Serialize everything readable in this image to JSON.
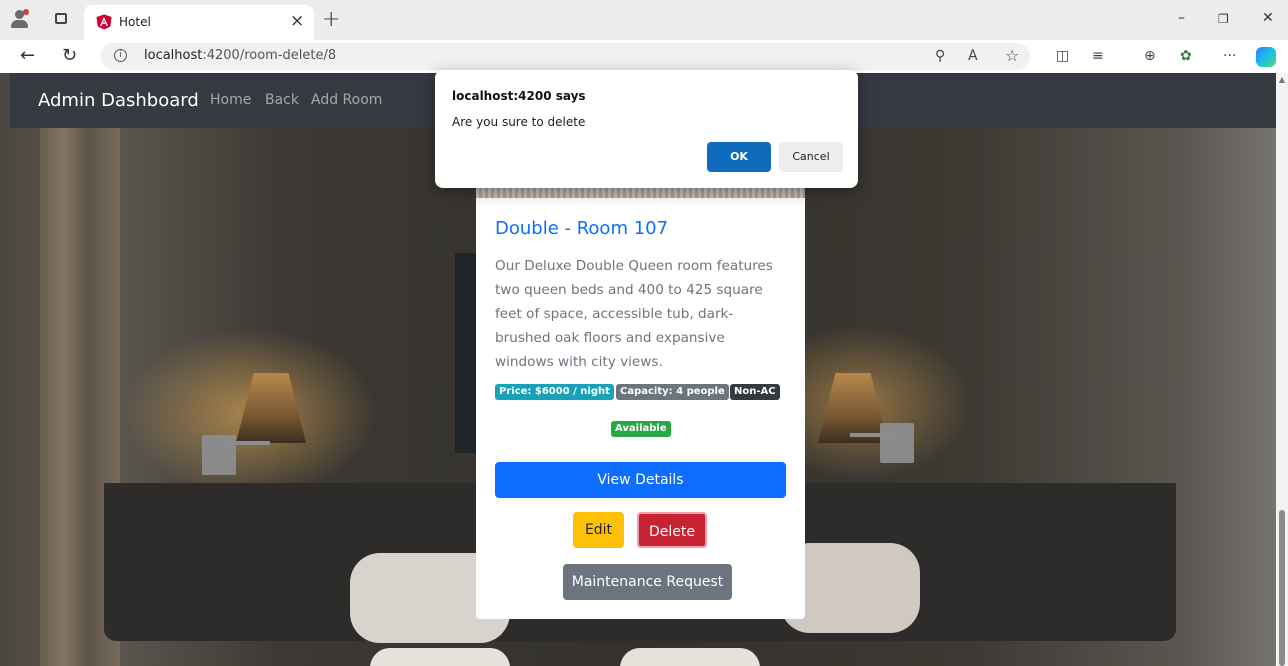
{
  "browser": {
    "tab_title": "Hotel",
    "tab_close_glyph": "×",
    "new_tab_glyph": "+",
    "url_host": "localhost",
    "url_rest": ":4200/room-delete/8",
    "info_glyph": "i",
    "window_controls": {
      "minimize": "–",
      "restore": "❐",
      "close": "✕"
    },
    "nav_icons": {
      "back": "←",
      "reload": "↻"
    },
    "toolbar_icons": {
      "key": "⚲",
      "read_aloud": "A",
      "favorite": "☆",
      "split": "◫",
      "favorites_list": "≡",
      "collections": "⊕",
      "extensions": "✿",
      "more": "···"
    }
  },
  "navbar": {
    "brand": "Admin Dashboard",
    "links": [
      "Home",
      "Back",
      "Add Room"
    ]
  },
  "room": {
    "title": "Double - Room 107",
    "description": "Our Deluxe Double Queen room features two queen beds and 400 to 425 square feet of space, accessible tub, dark-brushed oak floors and expansive windows with city views.",
    "badges": {
      "price": "Price: $6000 / night",
      "capacity": "Capacity: 4 people",
      "ac": "Non-AC",
      "status": "Available"
    },
    "buttons": {
      "view": "View Details",
      "edit": "Edit",
      "delete": "Delete",
      "maintenance": "Maintenance Request"
    }
  },
  "dialog": {
    "title": "localhost:4200 says",
    "message": "Are you sure to delete",
    "ok": "OK",
    "cancel": "Cancel"
  },
  "colors": {
    "primary": "#0d6efd",
    "info": "#17a2b8",
    "secondary": "#6c757d",
    "dark": "#343a40",
    "success": "#28a745",
    "warning": "#ffc107",
    "danger": "#dc3545",
    "dialog_ok": "#0f6cbd"
  }
}
